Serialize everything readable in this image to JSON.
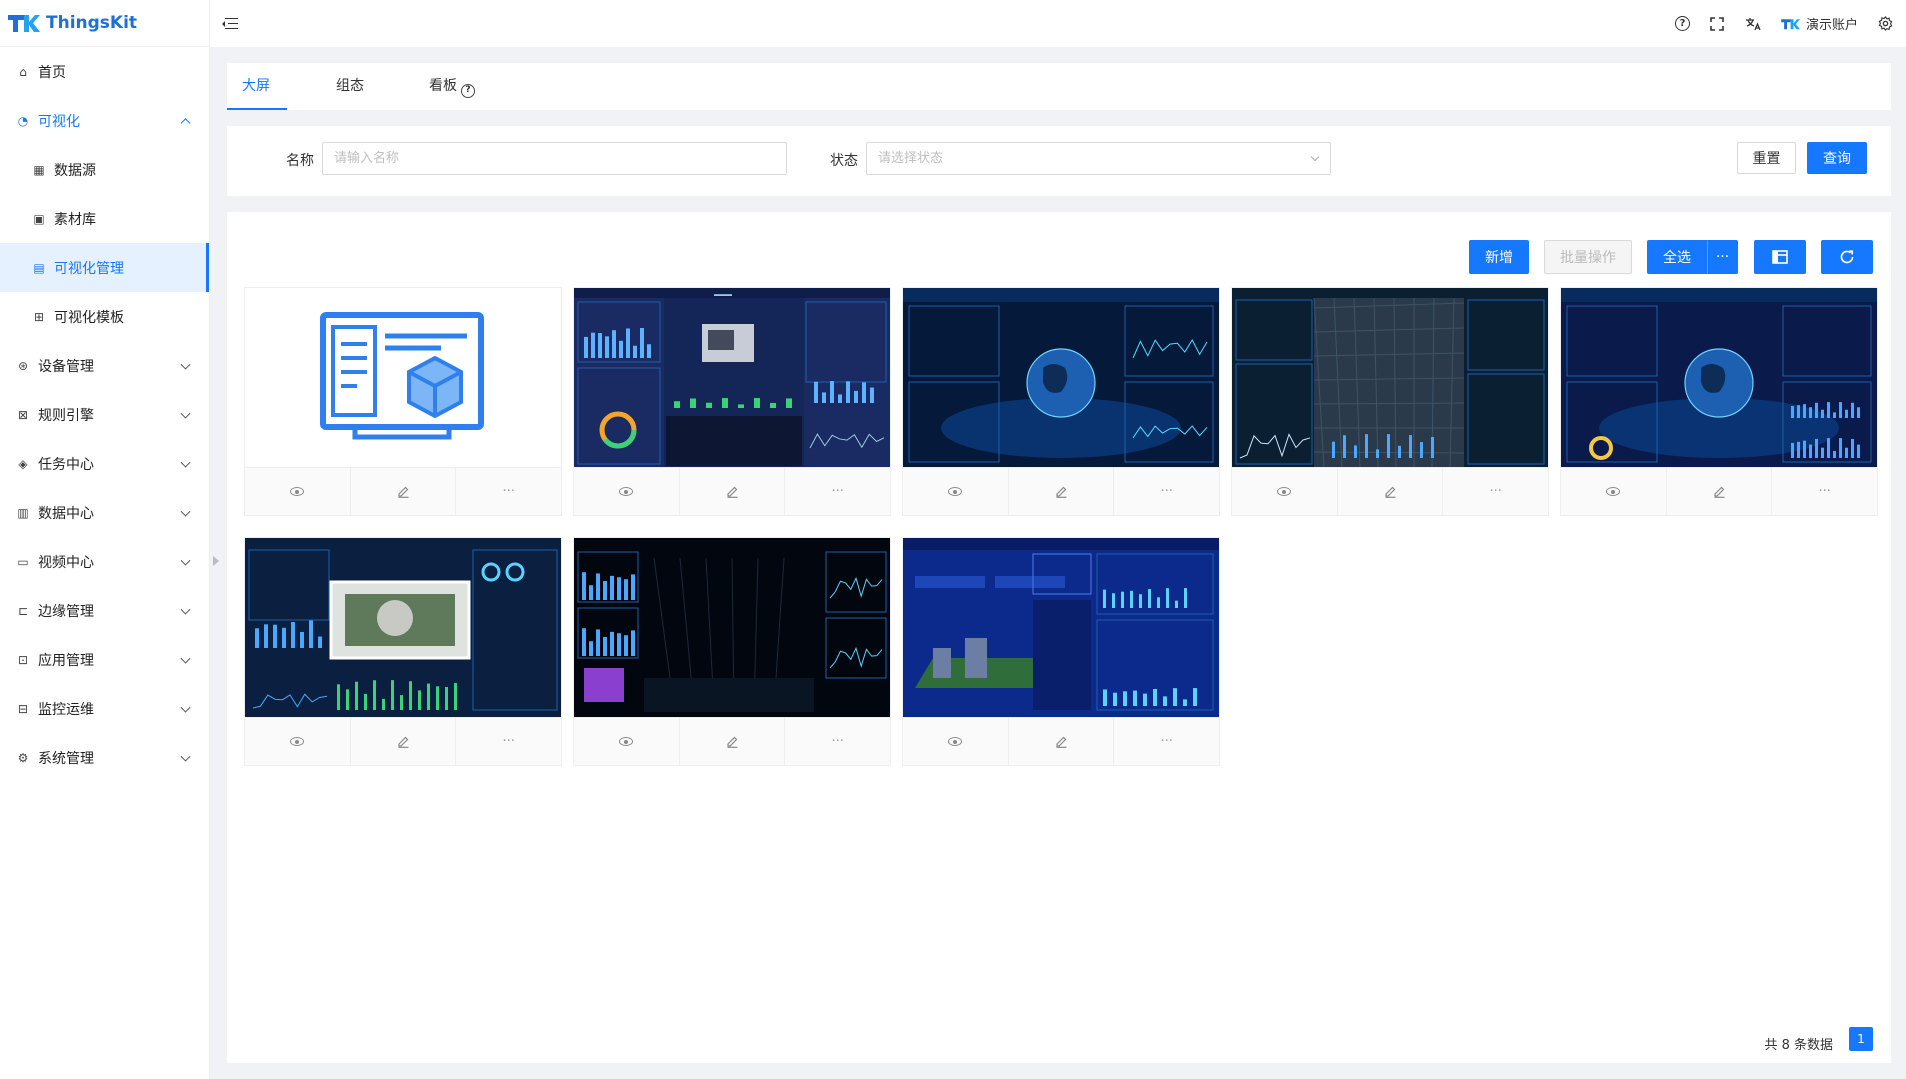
{
  "app": {
    "name": "ThingsKit"
  },
  "sidebar": {
    "items": [
      {
        "label": "首页",
        "icon": "home-icon",
        "type": "top"
      },
      {
        "label": "可视化",
        "icon": "dashboard-icon",
        "type": "open"
      },
      {
        "label": "数据源",
        "icon": "datasource-icon",
        "type": "sub"
      },
      {
        "label": "素材库",
        "icon": "image-icon",
        "type": "sub"
      },
      {
        "label": "可视化管理",
        "icon": "grid-icon",
        "type": "sub-active"
      },
      {
        "label": "可视化模板",
        "icon": "template-icon",
        "type": "sub"
      },
      {
        "label": "设备管理",
        "icon": "device-icon",
        "type": "group"
      },
      {
        "label": "规则引擎",
        "icon": "rule-icon",
        "type": "group"
      },
      {
        "label": "任务中心",
        "icon": "task-icon",
        "type": "group"
      },
      {
        "label": "数据中心",
        "icon": "chart-icon",
        "type": "group"
      },
      {
        "label": "视频中心",
        "icon": "video-icon",
        "type": "group"
      },
      {
        "label": "边缘管理",
        "icon": "edge-icon",
        "type": "group"
      },
      {
        "label": "应用管理",
        "icon": "app-icon",
        "type": "group"
      },
      {
        "label": "监控运维",
        "icon": "monitor-icon",
        "type": "group"
      },
      {
        "label": "系统管理",
        "icon": "settings-icon",
        "type": "group"
      }
    ]
  },
  "header": {
    "user": "演示账户"
  },
  "tabs": [
    {
      "label": "大屏"
    },
    {
      "label": "组态"
    },
    {
      "label": "看板"
    }
  ],
  "filter": {
    "name_label": "名称",
    "name_placeholder": "请输入名称",
    "status_label": "状态",
    "status_placeholder": "请选择状态",
    "reset": "重置",
    "query": "查询"
  },
  "toolbar": {
    "add": "新增",
    "batch": "批量操作",
    "select_all": "全选",
    "more": "···"
  },
  "cards": [
    {
      "thumb": "placeholder"
    },
    {
      "thumb": "industrial"
    },
    {
      "thumb": "globe"
    },
    {
      "thumb": "city"
    },
    {
      "thumb": "globe2"
    },
    {
      "thumb": "park"
    },
    {
      "thumb": "dark"
    },
    {
      "thumb": "factory"
    }
  ],
  "pagination": {
    "total_text": "共 8 条数据",
    "current": "1"
  }
}
